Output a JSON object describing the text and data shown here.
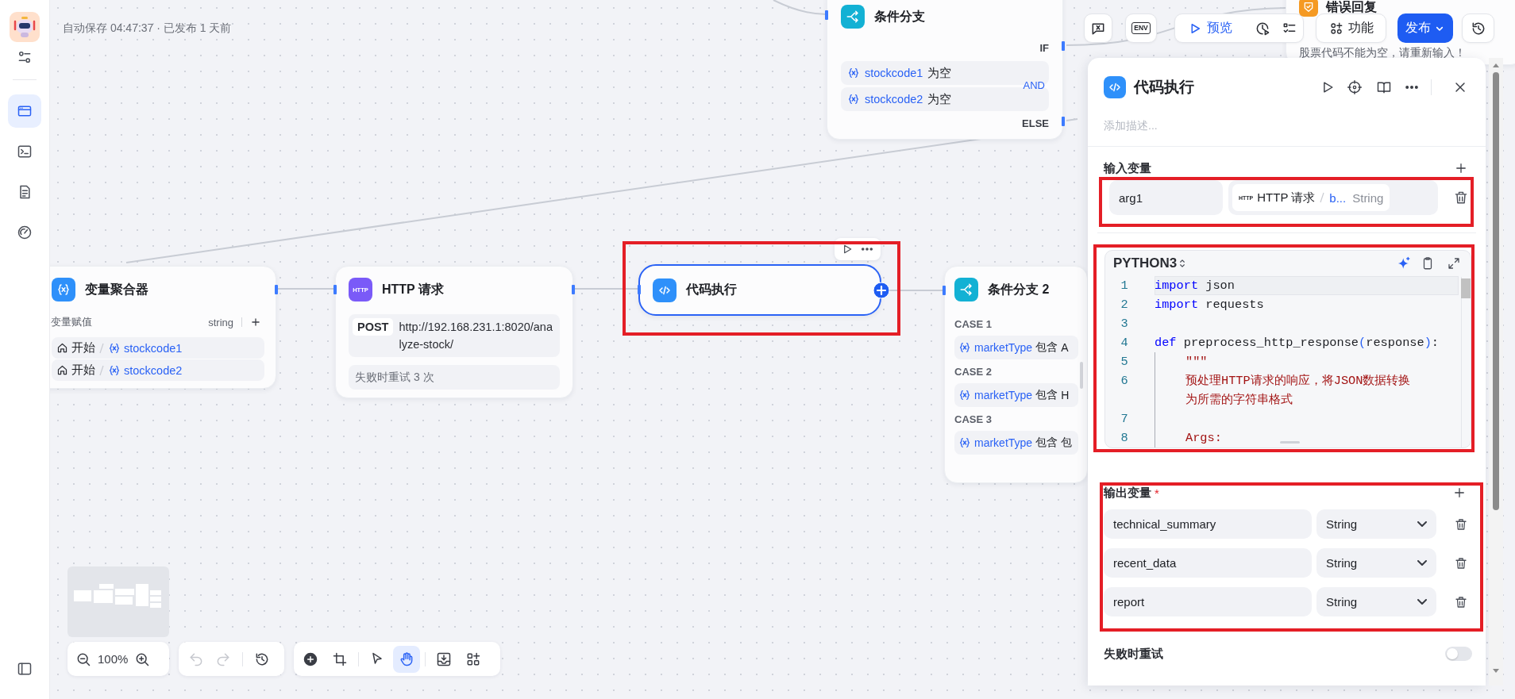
{
  "sidebar": {
    "items": [
      {
        "selected": false
      },
      {
        "selected": true
      },
      {
        "selected": false
      },
      {
        "selected": false
      },
      {
        "selected": false
      }
    ]
  },
  "status_text": "自动保存 04:47:37 · 已发布 1 天前",
  "nodes": [
    {
      "kind": "condition",
      "title": "条件分支",
      "if_label": "IF",
      "logic": "AND",
      "else_label": "ELSE",
      "conditions": [
        {
          "variable": "stockcode1",
          "operator": "为空"
        },
        {
          "variable": "stockcode2",
          "operator": "为空"
        }
      ]
    },
    {
      "kind": "error",
      "title": "错误回复",
      "message": "股票代码不能为空，请重新输入！"
    },
    {
      "kind": "aggregator",
      "title": "变量聚合器",
      "group_label": "变量赋值",
      "type_label": "string",
      "items": [
        {
          "source": "开始",
          "variable": "stockcode1"
        },
        {
          "source": "开始",
          "variable": "stockcode2"
        }
      ]
    },
    {
      "kind": "http",
      "title": "HTTP 请求",
      "badge": "HTTP",
      "method": "POST",
      "url": "http://192.168.231.1:8020/analyze-stock/",
      "retry": "失败时重试 3 次"
    },
    {
      "kind": "code",
      "title": "代码执行",
      "selected": true
    },
    {
      "kind": "switch",
      "title": "条件分支 2",
      "cases": [
        {
          "label": "CASE 1",
          "variable": "marketType",
          "operator": "包含",
          "value": "A"
        },
        {
          "label": "CASE 2",
          "variable": "marketType",
          "operator": "包含",
          "value": "H"
        },
        {
          "label": "CASE 3",
          "variable": "marketType",
          "operator": "包含",
          "value": "包"
        }
      ]
    }
  ],
  "toolbar": {
    "env_label": "ENV",
    "preview": "预览",
    "features": "功能",
    "publish": "发布"
  },
  "panel": {
    "title": "代码执行",
    "description": {
      "placeholder": "添加描述..."
    },
    "input_label": "输入变量",
    "inputs": [
      {
        "name": "arg1",
        "source_badge": "HTTP",
        "source": "HTTP 请求",
        "field": "b...",
        "type": "String"
      }
    ],
    "language": "PYTHON3",
    "code_lines": [
      {
        "number": "1",
        "current": true,
        "indent": false,
        "tokens": [
          {
            "text": "import",
            "kind": "keyword"
          },
          {
            "text": " json",
            "kind": "plain"
          }
        ]
      },
      {
        "number": "2",
        "current": false,
        "indent": false,
        "tokens": [
          {
            "text": "import",
            "kind": "keyword"
          },
          {
            "text": " requests",
            "kind": "plain"
          }
        ]
      },
      {
        "number": "3",
        "current": false,
        "indent": false
      },
      {
        "number": "4",
        "current": false,
        "indent": false,
        "tokens": [
          {
            "text": "def",
            "kind": "keyword"
          },
          {
            "text": " preprocess_http_response",
            "kind": "plain"
          },
          {
            "text": "(",
            "kind": "bracket"
          },
          {
            "text": "response",
            "kind": "plain"
          },
          {
            "text": ")",
            "kind": "bracket"
          },
          {
            "text": ":",
            "kind": "plain"
          }
        ]
      },
      {
        "number": "5",
        "current": false,
        "indent": true,
        "tokens": [
          {
            "text": "\"\"\"",
            "kind": "string"
          }
        ]
      },
      {
        "number": "6",
        "current": false,
        "indent": true,
        "tokens": [
          {
            "text": "预处理HTTP请求的响应，将JSON数据转换为所需的字符串格式",
            "kind": "string"
          }
        ]
      },
      {
        "number": "7",
        "current": false,
        "indent": true
      },
      {
        "number": "8",
        "current": false,
        "indent": true,
        "tokens": [
          {
            "text": "Args:",
            "kind": "string"
          }
        ]
      }
    ],
    "output_label": "输出变量",
    "required_mark": "*",
    "outputs": [
      {
        "name": "technical_summary",
        "type": "String"
      },
      {
        "name": "recent_data",
        "type": "String"
      },
      {
        "name": "report",
        "type": "String"
      }
    ],
    "retry_label": "失败时重试",
    "retry_on": false
  },
  "canvas_tools": {
    "zoom": "100%",
    "undo_disabled": true,
    "redo_disabled": true,
    "tools": [
      {
        "selected": false
      },
      {
        "selected": false
      },
      {
        "selected": false
      },
      {
        "selected": true
      },
      {
        "selected": false
      },
      {
        "selected": false
      }
    ]
  }
}
